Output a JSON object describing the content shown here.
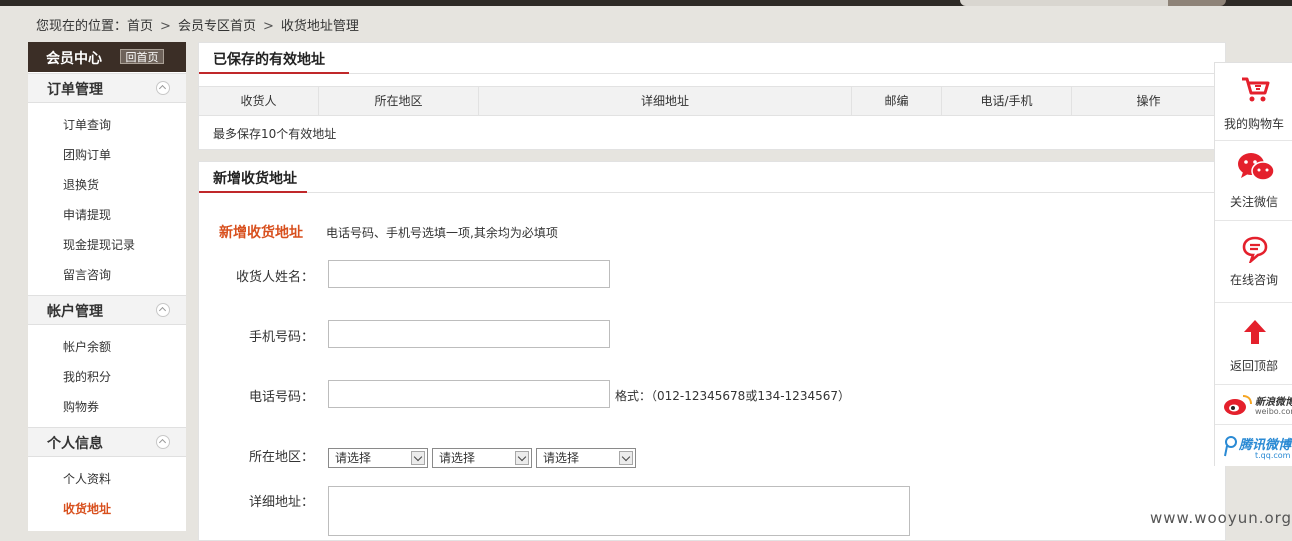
{
  "breadcrumb": {
    "prefix": "您现在的位置：",
    "items": [
      "首页",
      "会员专区首页",
      "收货地址管理"
    ],
    "sep": ">"
  },
  "sidebar": {
    "title": "会员中心",
    "home_button": "回首页",
    "sections": [
      {
        "title": "订单管理",
        "items": [
          "订单查询",
          "团购订单",
          "退换货",
          "申请提现",
          "现金提现记录",
          "留言咨询"
        ]
      },
      {
        "title": "帐户管理",
        "items": [
          "帐户余额",
          "我的积分",
          "购物券"
        ]
      },
      {
        "title": "个人信息",
        "items": [
          "个人资料",
          "收货地址"
        ]
      }
    ],
    "active_item": "收货地址"
  },
  "saved": {
    "title": "已保存的有效地址",
    "columns": [
      "收货人",
      "所在地区",
      "详细地址",
      "邮编",
      "电话/手机",
      "操作"
    ],
    "note": "最多保存10个有效地址"
  },
  "add": {
    "panel_title": "新增收货地址",
    "form_title": "新增收货地址",
    "hint": "电话号码、手机号选填一项,其余均为必填项",
    "fields": {
      "name_label": "收货人姓名：",
      "mobile_label": "手机号码：",
      "phone_label": "电话号码：",
      "phone_format": "格式：（012-12345678或134-1234567）",
      "region_label": "所在地区：",
      "region_options": [
        "请选择",
        "请选择",
        "请选择"
      ],
      "address_label": "详细地址："
    }
  },
  "float_bar": {
    "cart": "我的购物车",
    "wechat": "关注微信",
    "consult": "在线咨询",
    "top": "返回顶部",
    "weibo_sina": "新浪微博",
    "weibo_sina_sub": "weibo.com",
    "weibo_tencent": "腾讯微博",
    "weibo_tencent_sub": "t.qq.com",
    "colors": {
      "red": "#e4202c",
      "wechat": "#e4202c"
    }
  },
  "watermark": "www.wooyun.org"
}
